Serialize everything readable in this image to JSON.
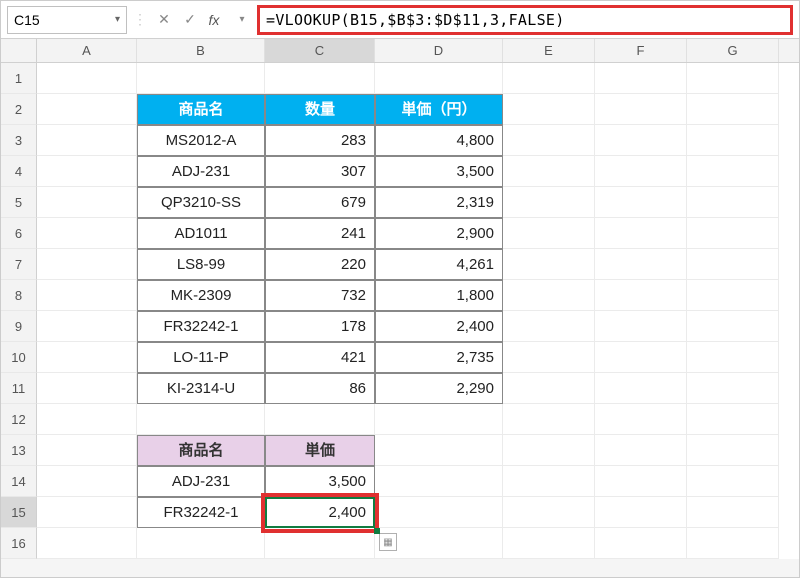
{
  "name_box": {
    "value": "C15"
  },
  "formula_bar": {
    "cancel_glyph": "✕",
    "accept_glyph": "✓",
    "fx_label": "fx",
    "formula": "=VLOOKUP(B15,$B$3:$D$11,3,FALSE)"
  },
  "columns": [
    "A",
    "B",
    "C",
    "D",
    "E",
    "F",
    "G"
  ],
  "rows": [
    "1",
    "2",
    "3",
    "4",
    "5",
    "6",
    "7",
    "8",
    "9",
    "10",
    "11",
    "12",
    "13",
    "14",
    "15",
    "16"
  ],
  "table1": {
    "headers": {
      "b": "商品名",
      "c": "数量",
      "d": "単価（円）"
    },
    "rows": [
      {
        "b": "MS2012-A",
        "c": "283",
        "d": "4,800"
      },
      {
        "b": "ADJ-231",
        "c": "307",
        "d": "3,500"
      },
      {
        "b": "QP3210-SS",
        "c": "679",
        "d": "2,319"
      },
      {
        "b": "AD1011",
        "c": "241",
        "d": "2,900"
      },
      {
        "b": "LS8-99",
        "c": "220",
        "d": "4,261"
      },
      {
        "b": "MK-2309",
        "c": "732",
        "d": "1,800"
      },
      {
        "b": "FR32242-1",
        "c": "178",
        "d": "2,400"
      },
      {
        "b": "LO-11-P",
        "c": "421",
        "d": "2,735"
      },
      {
        "b": "KI-2314-U",
        "c": "86",
        "d": "2,290"
      }
    ]
  },
  "table2": {
    "headers": {
      "b": "商品名",
      "c": "単価"
    },
    "rows": [
      {
        "b": "ADJ-231",
        "c": "3,500"
      },
      {
        "b": "FR32242-1",
        "c": "2,400"
      }
    ]
  },
  "chart_data": {
    "type": "table",
    "tables": [
      {
        "title": "価格表",
        "columns": [
          "商品名",
          "数量",
          "単価（円）"
        ],
        "rows": [
          [
            "MS2012-A",
            283,
            4800
          ],
          [
            "ADJ-231",
            307,
            3500
          ],
          [
            "QP3210-SS",
            679,
            2319
          ],
          [
            "AD1011",
            241,
            2900
          ],
          [
            "LS8-99",
            220,
            4261
          ],
          [
            "MK-2309",
            732,
            1800
          ],
          [
            "FR32242-1",
            178,
            2400
          ],
          [
            "LO-11-P",
            421,
            2735
          ],
          [
            "KI-2314-U",
            86,
            2290
          ]
        ]
      },
      {
        "title": "抽出",
        "columns": [
          "商品名",
          "単価"
        ],
        "rows": [
          [
            "ADJ-231",
            3500
          ],
          [
            "FR32242-1",
            2400
          ]
        ]
      }
    ]
  }
}
